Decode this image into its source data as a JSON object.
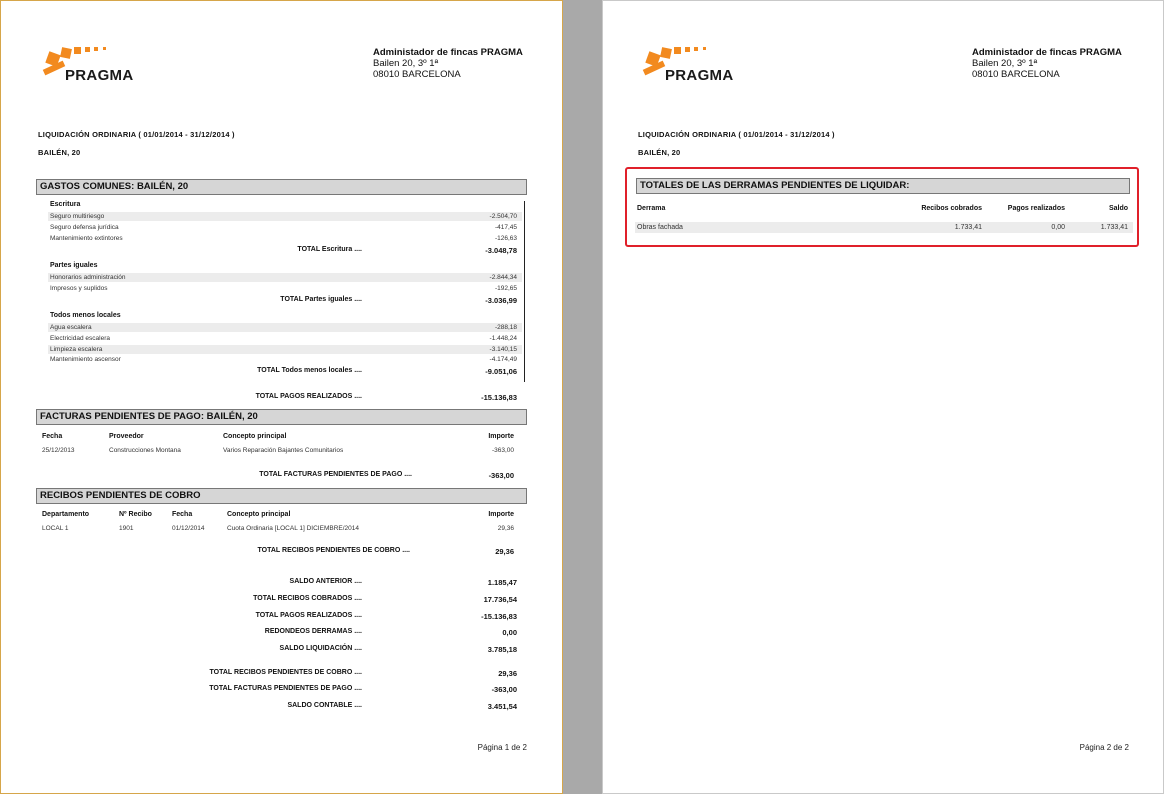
{
  "company": {
    "name": "Administador de fincas PRAGMA",
    "address": "Bailen 20, 3º 1ª",
    "city": "08010 BARCELONA",
    "logo_text": "PRAGMA"
  },
  "period_title": "LIQUIDACIÓN ORDINARIA ( 01/01/2014 - 31/12/2014 )",
  "community": "BAILÉN, 20",
  "page1": {
    "gastos": {
      "title": "GASTOS COMUNES: BAILÉN, 20",
      "groups": [
        {
          "name": "Escritura",
          "items": [
            {
              "label": "Seguro multiriesgo",
              "amount": "-2.504,70"
            },
            {
              "label": "Seguro defensa jurídica",
              "amount": "-417,45"
            },
            {
              "label": "Mantenimiento extintores",
              "amount": "-126,63"
            }
          ],
          "total_label": "TOTAL Escritura ....",
          "total": "-3.048,78"
        },
        {
          "name": "Partes iguales",
          "items": [
            {
              "label": "Honorarios administración",
              "amount": "-2.844,34"
            },
            {
              "label": "Impresos y suplidos",
              "amount": "-192,65"
            }
          ],
          "total_label": "TOTAL Partes iguales ....",
          "total": "-3.036,99"
        },
        {
          "name": "Todos menos locales",
          "items": [
            {
              "label": "Agua escalera",
              "amount": "-288,18"
            },
            {
              "label": "Electricidad escalera",
              "amount": "-1.448,24"
            },
            {
              "label": "Limpieza escalera",
              "amount": "-3.140,15"
            },
            {
              "label": "Mantenimiento ascensor",
              "amount": "-4.174,49"
            }
          ],
          "total_label": "TOTAL Todos menos locales ....",
          "total": "-9.051,06"
        }
      ],
      "grand_label": "TOTAL PAGOS REALIZADOS ....",
      "grand_total": "-15.136,83"
    },
    "facturas": {
      "title": "FACTURAS PENDIENTES DE PAGO: BAILÉN, 20",
      "headers": [
        "Fecha",
        "Proveedor",
        "Concepto principal",
        "Importe"
      ],
      "rows": [
        [
          "25/12/2013",
          "Construcciones Montana",
          "Varios Reparación Bajantes Comunitarios",
          "-363,00"
        ]
      ],
      "total_label": "TOTAL FACTURAS PENDIENTES DE PAGO ....",
      "total": "-363,00"
    },
    "recibos": {
      "title": "RECIBOS PENDIENTES DE COBRO",
      "headers": [
        "Departamento",
        "Nº Recibo",
        "Fecha",
        "Concepto principal",
        "Importe"
      ],
      "rows": [
        [
          "LOCAL 1",
          "1901",
          "01/12/2014",
          "Cuota Ordinaria [LOCAL 1] DICIEMBRE/2014",
          "29,36"
        ]
      ],
      "total_label": "TOTAL RECIBOS PENDIENTES DE COBRO ....",
      "total": "29,36"
    },
    "summary": [
      {
        "label": "SALDO ANTERIOR ....",
        "value": "1.185,47"
      },
      {
        "label": "TOTAL RECIBOS COBRADOS ....",
        "value": "17.736,54"
      },
      {
        "label": "TOTAL PAGOS REALIZADOS ....",
        "value": "-15.136,83"
      },
      {
        "label": "REDONDEOS DERRAMAS ....",
        "value": "0,00"
      },
      {
        "label": "SALDO LIQUIDACIÓN ....",
        "value": "3.785,18"
      },
      {
        "label": "TOTAL RECIBOS PENDIENTES DE COBRO ....",
        "value": "29,36"
      },
      {
        "label": "TOTAL FACTURAS PENDIENTES DE PAGO ....",
        "value": "-363,00"
      },
      {
        "label": "SALDO CONTABLE ....",
        "value": "3.451,54"
      }
    ],
    "page_number": "Página 1 de 2"
  },
  "page2": {
    "derramas": {
      "title": "TOTALES DE LAS DERRAMAS PENDIENTES DE LIQUIDAR:",
      "headers": [
        "Derrama",
        "Recibos cobrados",
        "Pagos realizados",
        "Saldo"
      ],
      "rows": [
        [
          "Obras fachada",
          "1.733,41",
          "0,00",
          "1.733,41"
        ]
      ]
    },
    "page_number": "Página 2 de 2"
  },
  "colors": {
    "logo_orange": "#f28a1f",
    "highlight_red": "#e0202a",
    "band_gray": "#d6d6d6"
  }
}
